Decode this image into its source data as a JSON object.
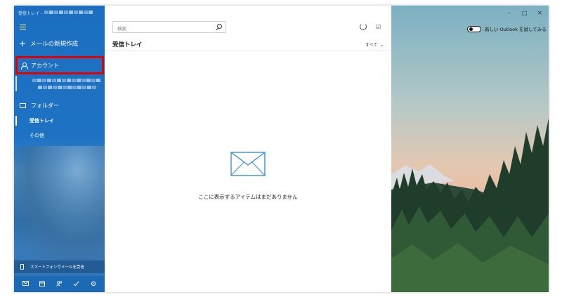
{
  "window": {
    "title": "受信トレイ - ",
    "minimize": "–",
    "maximize": "□",
    "close": "✕"
  },
  "sidebar": {
    "new_mail_label": "メールの新規作成",
    "account_label": "アカウント",
    "folders_label": "フォルダー",
    "folders": [
      {
        "label": "受信トレイ",
        "selected": true
      },
      {
        "label": "その他",
        "selected": false
      }
    ],
    "phone_label": "スマートフォンでメールを受信",
    "bottom_icons": [
      "mail-icon",
      "calendar-icon",
      "people-icon",
      "todo-icon",
      "settings-icon"
    ]
  },
  "list": {
    "search_placeholder": "検索",
    "title": "受信トレイ",
    "filter_label": "すべて",
    "empty_message": "ここに表示するアイテムはまだありません"
  },
  "right": {
    "try_outlook_label": "新しい Outlook を試してみる",
    "toggle_on": false
  },
  "colors": {
    "sidebar": "#1e72c4",
    "highlight_border": "#e00000",
    "envelope": "#3a8fd6"
  }
}
